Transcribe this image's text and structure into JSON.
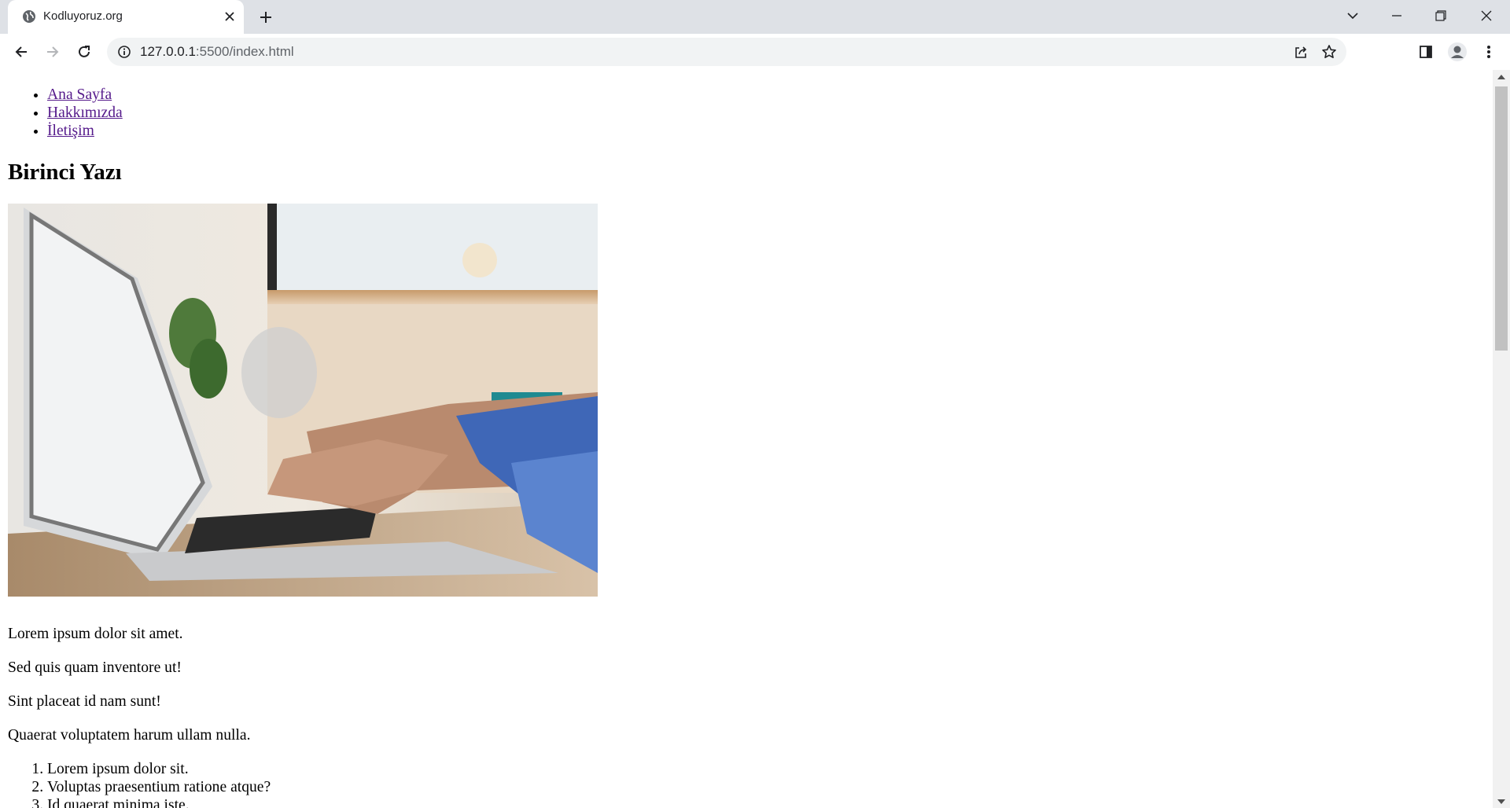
{
  "browser": {
    "tab_title": "Kodluyoruz.org",
    "url_host": "127.0.0.1",
    "url_path": ":5500/index.html"
  },
  "page": {
    "nav": [
      "Ana Sayfa",
      "Hakkımızda",
      "İletişim"
    ],
    "heading": "Birinci Yazı",
    "paragraphs": [
      "Lorem ipsum dolor sit amet.",
      "Sed quis quam inventore ut!",
      "Sint placeat id nam sunt!",
      "Quaerat voluptatem harum ullam nulla."
    ],
    "list": [
      "Lorem ipsum dolor sit.",
      "Voluptas praesentium ratione atque?",
      "Id quaerat minima iste."
    ]
  },
  "colors": {
    "tabstrip": "#dee1e6",
    "link_visited": "#551a8b",
    "omnibox": "#f1f3f4"
  },
  "icons": [
    "globe-icon",
    "close-icon",
    "plus-icon",
    "chevron-down-icon",
    "minimize-icon",
    "restore-icon",
    "window-close-icon",
    "back-icon",
    "forward-icon",
    "reload-icon",
    "info-icon",
    "share-icon",
    "star-icon",
    "side-panel-icon",
    "profile-icon",
    "menu-icon"
  ]
}
